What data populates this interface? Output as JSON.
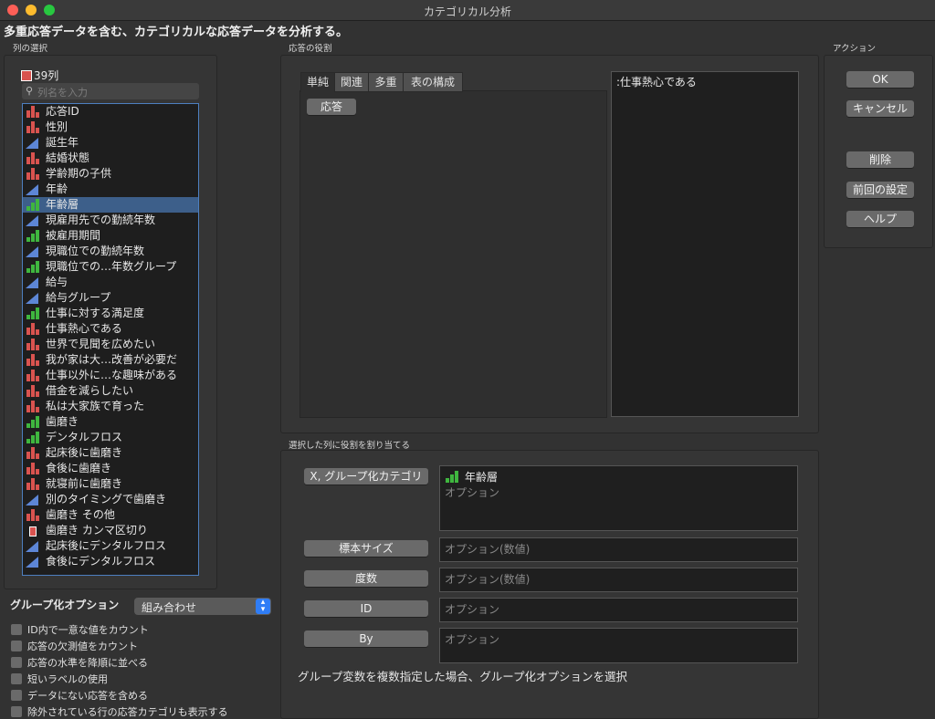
{
  "window": {
    "title": "カテゴリカル分析",
    "heading": "多重応答データを含む、カテゴリカルな応答データを分析する。"
  },
  "colors": {
    "close": "#fe5f57",
    "minimize": "#febc2e",
    "zoom": "#28c840",
    "selection": "#3d5f8a",
    "nominal": "#d9534f",
    "ordinal": "#3fb63f",
    "continuous": "#5d86d6"
  },
  "column_select": {
    "label": "列の選択",
    "count": "39列",
    "search_placeholder": "列名を入力",
    "items": [
      {
        "label": "応答ID",
        "type": "nominal"
      },
      {
        "label": "性別",
        "type": "nominal"
      },
      {
        "label": "誕生年",
        "type": "continuous"
      },
      {
        "label": "結婚状態",
        "type": "nominal"
      },
      {
        "label": "学齢期の子供",
        "type": "nominal"
      },
      {
        "label": "年齢",
        "type": "continuous"
      },
      {
        "label": "年齢層",
        "type": "ordinal",
        "selected": true
      },
      {
        "label": "現雇用先での勤続年数",
        "type": "continuous"
      },
      {
        "label": "被雇用期間",
        "type": "ordinal"
      },
      {
        "label": "現職位での勤続年数",
        "type": "continuous"
      },
      {
        "label": "現職位での…年数グループ",
        "type": "ordinal"
      },
      {
        "label": "給与",
        "type": "continuous"
      },
      {
        "label": "給与グループ",
        "type": "continuous"
      },
      {
        "label": "仕事に対する満足度",
        "type": "ordinal"
      },
      {
        "label": "仕事熱心である",
        "type": "nominal"
      },
      {
        "label": "世界で見聞を広めたい",
        "type": "nominal"
      },
      {
        "label": "我が家は大…改善が必要だ",
        "type": "nominal"
      },
      {
        "label": "仕事以外に…な趣味がある",
        "type": "nominal"
      },
      {
        "label": "借金を減らしたい",
        "type": "nominal"
      },
      {
        "label": "私は大家族で育った",
        "type": "nominal"
      },
      {
        "label": "歯磨き",
        "type": "ordinal"
      },
      {
        "label": "デンタルフロス",
        "type": "ordinal"
      },
      {
        "label": "起床後に歯磨き",
        "type": "nominal"
      },
      {
        "label": "食後に歯磨き",
        "type": "nominal"
      },
      {
        "label": "就寝前に歯磨き",
        "type": "nominal"
      },
      {
        "label": "別のタイミングで歯磨き",
        "type": "continuous"
      },
      {
        "label": "歯磨き その他",
        "type": "nominal"
      },
      {
        "label": "歯磨き カンマ区切り",
        "type": "multiple"
      },
      {
        "label": "起床後にデンタルフロス",
        "type": "continuous"
      },
      {
        "label": "食後にデンタルフロス",
        "type": "continuous"
      }
    ]
  },
  "grouping": {
    "label": "グループ化オプション",
    "value": "組み合わせ",
    "options": [
      "ID内で一意な値をカウント",
      "応答の欠測値をカウント",
      "応答の水準を降順に並べる",
      "短いラベルの使用",
      "データにない応答を含める",
      "除外されている行の応答カテゴリも表示する"
    ]
  },
  "response_roles": {
    "label": "応答の役割",
    "tabs": [
      "単純",
      "関連",
      "多重",
      "表の構成"
    ],
    "response_button": "応答",
    "assigned": ":仕事熱心である"
  },
  "assign_roles": {
    "label": "選択した列に役割を割り当てる",
    "roles": [
      {
        "button": "X, グループ化カテゴリ",
        "value": "年齢層",
        "placeholder": "オプション"
      },
      {
        "button": "標本サイズ",
        "placeholder": "オプション(数値)"
      },
      {
        "button": "度数",
        "placeholder": "オプション(数値)"
      },
      {
        "button": "ID",
        "placeholder": "オプション"
      },
      {
        "button": "By",
        "placeholder": "オプション"
      }
    ],
    "note": "グループ変数を複数指定した場合、グループ化オプションを選択"
  },
  "actions": {
    "label": "アクション",
    "ok": "OK",
    "cancel": "キャンセル",
    "remove": "削除",
    "recall": "前回の設定",
    "help": "ヘルプ"
  }
}
